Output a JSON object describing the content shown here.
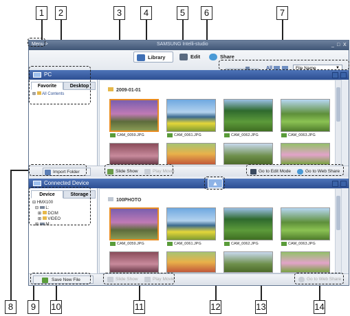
{
  "callouts": [
    "1",
    "2",
    "3",
    "4",
    "5",
    "6",
    "7",
    "8",
    "9",
    "10",
    "11",
    "12",
    "13",
    "14"
  ],
  "window": {
    "menu_label": "Menu >",
    "app_title": "SAMSUNG Intelli-studio",
    "controls": [
      "_",
      "□",
      "X"
    ]
  },
  "toolbar": {
    "library": "Library",
    "edit": "Edit",
    "share": "Share",
    "view_all": "All",
    "sort_selected": "File Name"
  },
  "pc_panel": {
    "title": "PC",
    "tabs": [
      "Favorite",
      "Desktop"
    ],
    "tree_item": "All Contents",
    "folder": "2009-01-01",
    "thumbs": [
      "CAM_0059.JPG",
      "CAM_0061.JPG",
      "CAM_0062.JPG",
      "CAM_0063.JPG"
    ],
    "import_button": "Import Folder",
    "slide_show": "Slide Show",
    "play_movie": "Play Movie",
    "edit_mode": "Go to Edit Mode",
    "web_share": "Go to Web Share"
  },
  "device_panel": {
    "title": "Connected Device",
    "tabs": [
      "Device",
      "Storage"
    ],
    "tree": [
      "HMX100",
      "L:",
      "DCIM",
      "VIDEO",
      "M:"
    ],
    "folder": "100PHOTO",
    "thumbs": [
      "CAM_0059.JPG",
      "CAM_0061.JPG",
      "CAM_0062.JPG",
      "CAM_0063.JPG"
    ],
    "save_button": "Save New File",
    "slide_show": "Slide Show",
    "play_movie": "Play Movie",
    "web_share": "Go to Web Share"
  },
  "colors": {
    "accent": "#2d4f93",
    "selection": "#e88b1f"
  }
}
